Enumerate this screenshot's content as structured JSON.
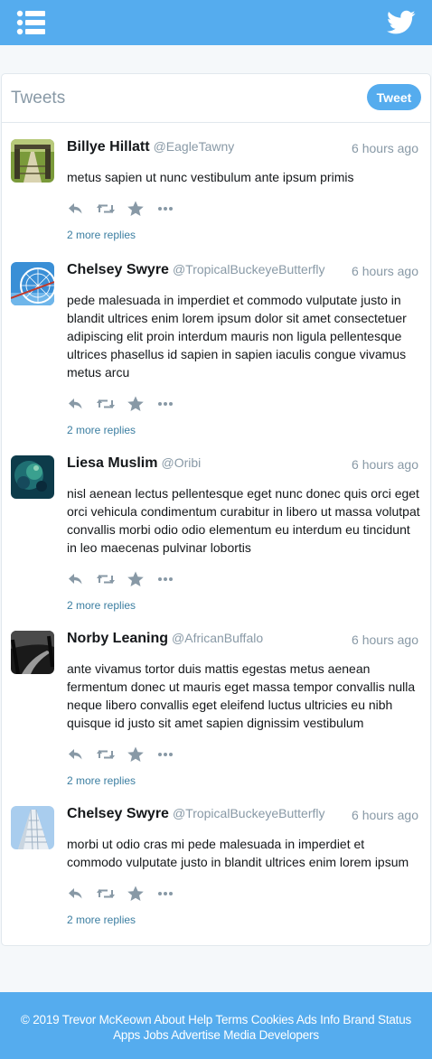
{
  "colors": {
    "brand": "#55acee",
    "link": "#3b7ea1",
    "muted": "#8899a6"
  },
  "topbar": {
    "menu_icon": "list-icon",
    "logo_icon": "twitter-bird-icon"
  },
  "timeline": {
    "title": "Tweets",
    "tweet_button": "Tweet",
    "tweets": [
      {
        "name": "Billye Hillatt",
        "handle": "@EagleTawny",
        "time": "6 hours ago",
        "text": "metus sapien ut nunc vestibulum ante ipsum primis",
        "replies": "2 more replies",
        "avatar": "bridge-photo"
      },
      {
        "name": "Chelsey Swyre",
        "handle": "@TropicalBuckeyeButterfly",
        "time": "6 hours ago",
        "text": "pede malesuada in imperdiet et commodo vulputate justo in blandit ultrices enim lorem ipsum dolor sit amet consectetuer adipiscing elit proin interdum mauris non ligula pellentesque ultrices phasellus id sapien in sapien iaculis congue vivamus metus arcu",
        "replies": "2 more replies",
        "avatar": "ferris-wheel-photo"
      },
      {
        "name": "Liesa Muslim",
        "handle": "@Oribi",
        "time": "6 hours ago",
        "text": "nisl aenean lectus pellentesque eget nunc donec quis orci eget orci vehicula condimentum curabitur in libero ut massa volutpat convallis morbi odio odio elementum eu interdum eu tincidunt in leo maecenas pulvinar lobortis",
        "replies": "2 more replies",
        "avatar": "underwater-photo"
      },
      {
        "name": "Norby Leaning",
        "handle": "@AfricanBuffalo",
        "time": "6 hours ago",
        "text": "ante vivamus tortor duis mattis egestas metus aenean fermentum donec ut mauris eget massa tempor convallis nulla neque libero convallis eget eleifend luctus ultricies eu nibh quisque id justo sit amet sapien dignissim vestibulum",
        "replies": "2 more replies",
        "avatar": "dark-road-photo"
      },
      {
        "name": "Chelsey Swyre",
        "handle": "@TropicalBuckeyeButterfly",
        "time": "6 hours ago",
        "text": "morbi ut odio cras mi pede malesuada in imperdiet et commodo vulputate justo in blandit ultrices enim lorem ipsum",
        "replies": "2 more replies",
        "avatar": "skyscraper-photo"
      }
    ]
  },
  "footer": {
    "line1": [
      "© 2019 Trevor McKeown",
      "About",
      "Help",
      "Terms",
      "Cookies",
      "Ads Info",
      "Brand",
      "Status"
    ],
    "line2": [
      "Apps",
      "Jobs",
      "Advertise",
      "Media",
      "Developers"
    ]
  }
}
